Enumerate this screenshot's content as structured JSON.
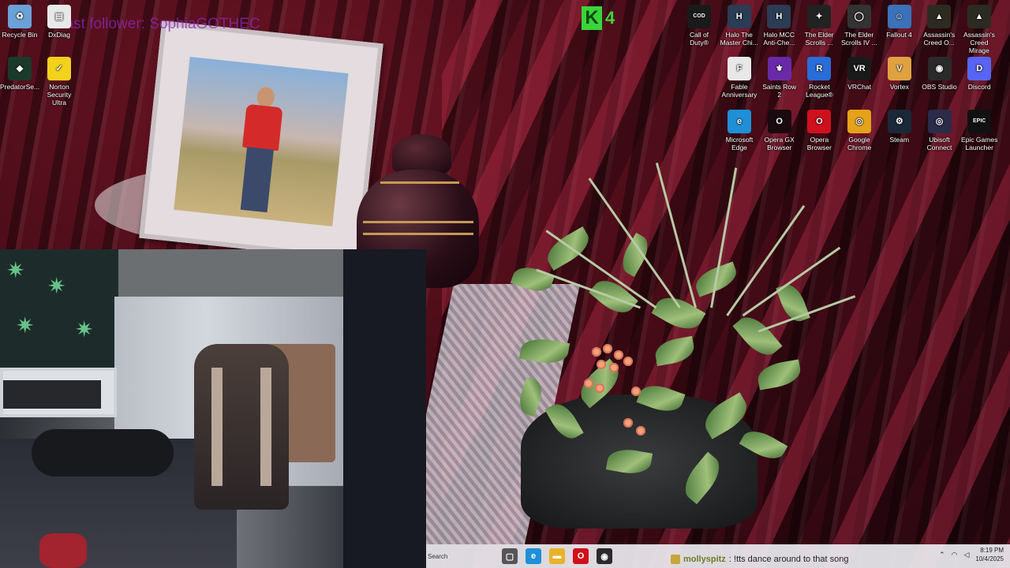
{
  "desktop": {
    "overlay_text": "Last follower: SophiaGOTHEC",
    "kbadge": {
      "letter": "K",
      "number": "4"
    },
    "left_icons": [
      {
        "label": "Recycle Bin",
        "icon": "recycle-bin-icon",
        "color": "#6aa2d8",
        "glyph": "♻"
      },
      {
        "label": "DxDiag",
        "icon": "dxdiag-icon",
        "color": "#e8e8e8",
        "glyph": "▤"
      },
      {
        "label": "PredatorSe...",
        "icon": "predatorsense-icon",
        "color": "#1c3a2b",
        "glyph": "◆"
      },
      {
        "label": "Norton Security Ultra",
        "icon": "norton-icon",
        "color": "#f2d21c",
        "glyph": "✓"
      }
    ],
    "right_icons_row1": [
      {
        "label": "Call of Duty®",
        "icon": "call-of-duty-icon",
        "color": "#1a1a1a",
        "glyph": "COD"
      },
      {
        "label": "Halo The Master Chi...",
        "icon": "halo-mcc-icon",
        "color": "#2b3c55",
        "glyph": "H"
      },
      {
        "label": "Halo MCC Anti-Che...",
        "icon": "halo-mcc-anticheat-icon",
        "color": "#2b3c55",
        "glyph": "H"
      },
      {
        "label": "The Elder Scrolls ...",
        "icon": "elder-scrolls-icon",
        "color": "#222",
        "glyph": "✦"
      },
      {
        "label": "The Elder Scrolls IV ...",
        "icon": "oblivion-icon",
        "color": "#333",
        "glyph": "◯"
      },
      {
        "label": "Fallout 4",
        "icon": "fallout4-icon",
        "color": "#3a71b8",
        "glyph": "☺"
      },
      {
        "label": "Assassin's Creed O...",
        "icon": "assassins-creed-origins-icon",
        "color": "#2b2b22",
        "glyph": "▲"
      },
      {
        "label": "Assassin's Creed Mirage",
        "icon": "assassins-creed-mirage-icon",
        "color": "#2b2b22",
        "glyph": "▲"
      }
    ],
    "right_icons_row2": [
      {
        "label": "Fable Anniversary",
        "icon": "fable-icon",
        "color": "#e8e8e8",
        "glyph": "F"
      },
      {
        "label": "Saints Row 2",
        "icon": "saints-row-icon",
        "color": "#6a2aa8",
        "glyph": "⚜"
      },
      {
        "label": "Rocket League®",
        "icon": "rocket-league-icon",
        "color": "#2a6cd8",
        "glyph": "R"
      },
      {
        "label": "VRChat",
        "icon": "vrchat-icon",
        "color": "#1a1a1a",
        "glyph": "VR"
      },
      {
        "label": "Vortex",
        "icon": "vortex-icon",
        "color": "#e0a240",
        "glyph": "V"
      },
      {
        "label": "OBS Studio",
        "icon": "obs-icon",
        "color": "#2a2a2a",
        "glyph": "◉"
      },
      {
        "label": "Discord",
        "icon": "discord-icon",
        "color": "#5865f2",
        "glyph": "D"
      }
    ],
    "right_icons_row3": [
      {
        "label": "Microsoft Edge",
        "icon": "edge-icon",
        "color": "#1f8fd6",
        "glyph": "e"
      },
      {
        "label": "Opera GX Browser",
        "icon": "opera-gx-icon",
        "color": "#1a0a10",
        "glyph": "O"
      },
      {
        "label": "Opera Browser",
        "icon": "opera-icon",
        "color": "#d0101c",
        "glyph": "O"
      },
      {
        "label": "Google Chrome",
        "icon": "chrome-icon",
        "color": "#e6a21a",
        "glyph": "◎"
      },
      {
        "label": "Steam",
        "icon": "steam-icon",
        "color": "#1b2838",
        "glyph": "⚙"
      },
      {
        "label": "Ubisoft Connect",
        "icon": "ubisoft-icon",
        "color": "#2b2b4a",
        "glyph": "◎"
      },
      {
        "label": "Epic Games Launcher",
        "icon": "epic-games-icon",
        "color": "#111",
        "glyph": "EPIC"
      }
    ]
  },
  "taskbar": {
    "search_placeholder": "Search",
    "apps": [
      {
        "icon": "task-view-icon",
        "color": "#555",
        "glyph": "▢"
      },
      {
        "icon": "edge-icon",
        "color": "#1f8fd6",
        "glyph": "e"
      },
      {
        "icon": "file-explorer-icon",
        "color": "#e8b22a",
        "glyph": "▬"
      },
      {
        "icon": "opera-icon",
        "color": "#d0101c",
        "glyph": "O"
      },
      {
        "icon": "obs-icon",
        "color": "#2a2a2a",
        "glyph": "◉"
      }
    ],
    "time": "8:19 PM",
    "date": "10/4/2025"
  },
  "chat": {
    "user": "mollyspitz",
    "message": ": !tts dance around to that song"
  }
}
